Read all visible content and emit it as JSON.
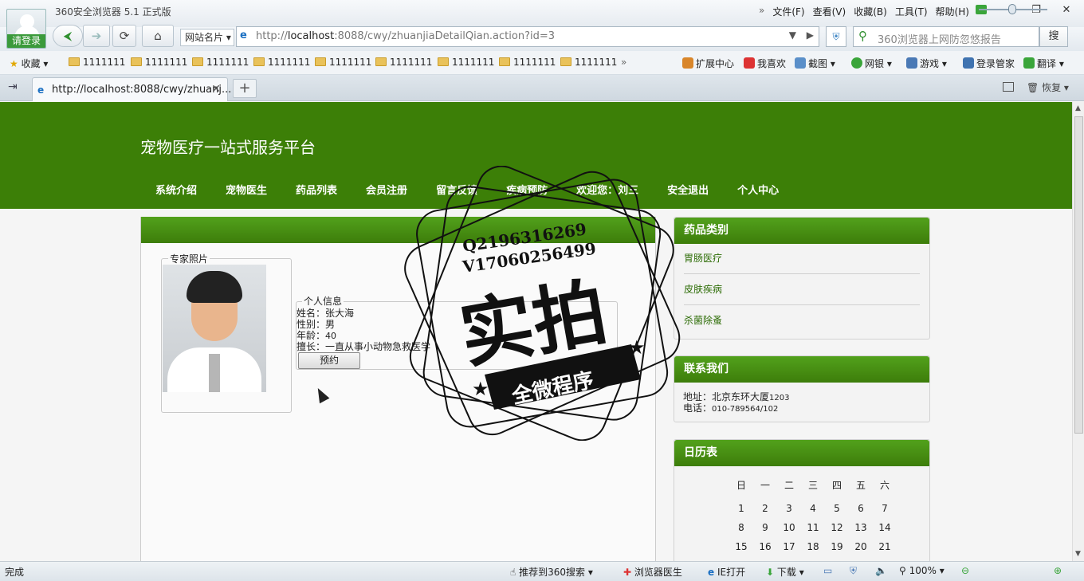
{
  "browser": {
    "app_title": "360安全浏览器 5.1 正式版",
    "login_label": "请登录",
    "menu": [
      "文件(F)",
      "查看(V)",
      "收藏(B)",
      "工具(T)",
      "帮助(H)"
    ],
    "address_prefix": "http://",
    "address_host": "localhost",
    "address_rest": ":8088/cwy/zhuanjiaDetailQian.action?id=3",
    "site_card_label": "网站名片",
    "search_placeholder": "360浏览器上网防忽悠报告",
    "search_button": "搜",
    "favorites_label": "收藏",
    "bookmark": "1111111",
    "tools": [
      "扩展中心",
      "我喜欢",
      "截图",
      "网银",
      "游戏",
      "登录管家",
      "翻译"
    ],
    "tab_title": "http://localhost:8088/cwy/zhuanj...",
    "restore_label": "恢复"
  },
  "site": {
    "title": "宠物医疗一站式服务平台",
    "nav": [
      "系统介绍",
      "宠物医生",
      "药品列表",
      "会员注册",
      "留言反馈",
      "疾病预防",
      "欢迎您：刘三",
      "安全退出",
      "个人中心"
    ]
  },
  "expert": {
    "photo_legend": "专家照片",
    "info_legend": "个人信息",
    "name_label": "姓名：",
    "name": "张大海",
    "gender_label": "性别：",
    "gender": "男",
    "age_label": "年龄：",
    "age": "40",
    "specialty_label": "擅长：",
    "specialty": "一直从事小动物急救医学",
    "book_button": "预约"
  },
  "sidebar": {
    "categories_title": "药品类别",
    "categories": [
      "胃肠医疗",
      "皮肤疾病",
      "杀菌除蚤"
    ],
    "contact_title": "联系我们",
    "address_label": "地址：北京东环大厦",
    "address_num": "1203",
    "phone_label": "电话：",
    "phone": "010-789564/102",
    "calendar_title": "日历表",
    "weekdays": [
      "日",
      "一",
      "二",
      "三",
      "四",
      "五",
      "六"
    ],
    "weeks": [
      [
        "1",
        "2",
        "3",
        "4",
        "5",
        "6",
        "7"
      ],
      [
        "8",
        "9",
        "10",
        "11",
        "12",
        "13",
        "14"
      ],
      [
        "15",
        "16",
        "17",
        "18",
        "19",
        "20",
        "21"
      ]
    ]
  },
  "watermark": {
    "contact1": "Q2196316269",
    "contact2": "V17060256499",
    "big_text": "实拍",
    "ribbon_text": "全微程序"
  },
  "status": {
    "left": "完成",
    "recommend": "推荐到360搜索",
    "doctor": "浏览器医生",
    "ie_open": "IE打开",
    "download": "下载",
    "zoom": "100%"
  },
  "colors": {
    "brand_green": "#3c7f07",
    "header_green": "#52a11c",
    "link_green": "#2e6d07"
  }
}
